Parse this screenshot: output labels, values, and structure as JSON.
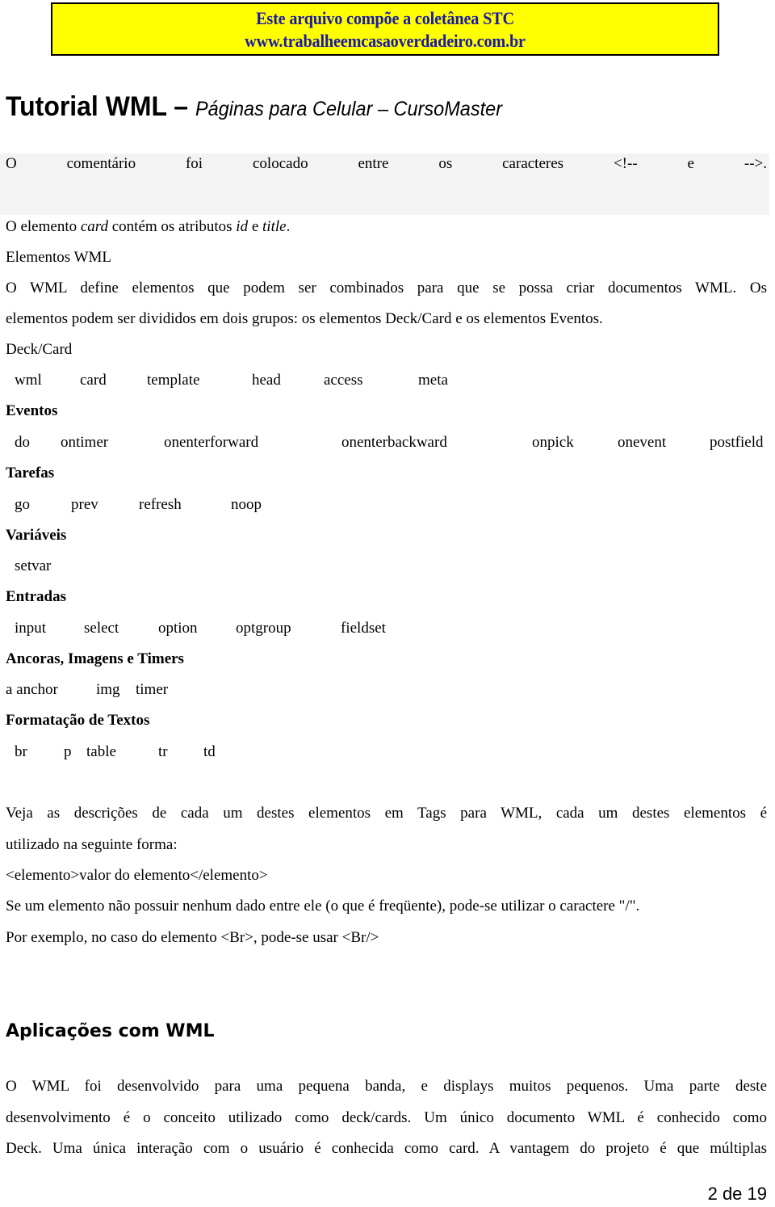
{
  "banner": {
    "line1": "Este arquivo compõe a coletânea STC",
    "line2": "www.trabalheemcasaoverdadeiro.com.br",
    "background": "#ffff00",
    "text_color": "#1a1aa6"
  },
  "title": {
    "main": "Tutorial WML – ",
    "subtitle": "Páginas para Celular – CursoMaster"
  },
  "comment_line": [
    "O",
    "comentário",
    "foi",
    "colocado",
    "entre",
    "os",
    "caracteres",
    "<!--",
    "e",
    "-->."
  ],
  "card_line": {
    "pre": "O elemento ",
    "card": "card",
    "mid": " contém os atributos ",
    "id": "id",
    "and": " e ",
    "title": "title",
    "end": "."
  },
  "elements_heading": "Elementos WML",
  "intro_para": {
    "line1": "O WML define elementos que podem ser combinados para que se possa criar documentos WML. Os",
    "line2": "elementos podem ser divididos em dois grupos: os elementos Deck/Card e os elementos Eventos."
  },
  "groups": [
    {
      "heading": "Deck/Card",
      "bold": false,
      "items": [
        "wml",
        "card",
        "template",
        "head",
        "access",
        "meta"
      ]
    },
    {
      "heading": "Eventos",
      "bold": true,
      "items": [
        "do",
        "ontimer",
        "onenterforward",
        "onenterbackward",
        "onpick",
        "onevent",
        "postfield"
      ]
    },
    {
      "heading": "Tarefas",
      "bold": true,
      "items": [
        "go",
        "prev",
        "refresh",
        "noop"
      ]
    },
    {
      "heading": "Variáveis",
      "bold": true,
      "items": [
        "setvar"
      ]
    },
    {
      "heading": "Entradas",
      "bold": true,
      "items": [
        "input",
        "select",
        "option",
        "optgroup",
        "fieldset"
      ]
    },
    {
      "heading": "Ancoras, Imagens e Timers",
      "bold": true,
      "items": [
        "a anchor",
        "img",
        "timer"
      ]
    },
    {
      "heading": "Formatação de Textos",
      "bold": true,
      "items": [
        "br",
        "p",
        "table",
        "tr",
        "td"
      ]
    }
  ],
  "usage_para": {
    "line1": "Veja as descrições de cada um destes elementos em Tags para WML, cada um destes elementos é",
    "line2": "utilizado na seguinte forma:",
    "line3": "<elemento>valor do elemento</elemento>",
    "line4": "Se um elemento não possuir nenhum dado entre ele (o que é freqüente), pode-se utilizar o caractere \"/\".",
    "line5": "Por exemplo, no caso do elemento <Br>, pode-se usar <Br/>"
  },
  "applications": {
    "heading": "Aplicações com WML",
    "line1": "O WML foi desenvolvido para uma pequena banda, e displays muitos pequenos. Uma parte deste",
    "line2": "desenvolvimento é o conceito utilizado como deck/cards. Um único documento WML é conhecido como",
    "line3": "Deck. Uma única interação com o usuário é conhecida como card. A vantagem do projeto é que múltiplas"
  },
  "page_number": "2 de 19"
}
